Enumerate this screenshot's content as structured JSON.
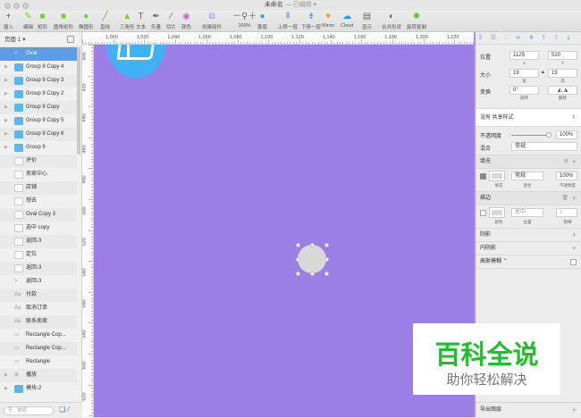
{
  "window": {
    "title": "未命名",
    "status": "— 已编辑 ▾"
  },
  "toolbar": {
    "items": [
      {
        "label": "插入",
        "icon": "plus-icon"
      },
      {
        "label": "编辑",
        "icon": "edit-icon"
      },
      {
        "label": "矩形",
        "icon": "rectangle-icon"
      },
      {
        "label": "圆角矩形",
        "icon": "rounded-rectangle-icon"
      },
      {
        "label": "椭圆形",
        "icon": "oval-icon"
      },
      {
        "label": "直线",
        "icon": "line-icon"
      },
      {
        "label": "三角形",
        "icon": "triangle-icon"
      },
      {
        "label": "文本",
        "icon": "text-icon"
      },
      {
        "label": "矢量",
        "icon": "vector-icon"
      },
      {
        "label": "切片",
        "icon": "slice-icon"
      },
      {
        "label": "颜色",
        "icon": "color-wheel-icon"
      },
      {
        "label": "创建组件",
        "icon": "symbol-icon"
      },
      {
        "label": "309%",
        "icon": "zoom-icon"
      },
      {
        "label": "蒙版",
        "icon": "mask-icon"
      },
      {
        "label": "上移一层",
        "icon": "forward-icon"
      },
      {
        "label": "下移一层",
        "icon": "backward-icon"
      },
      {
        "label": "Mirror",
        "icon": "mirror-icon"
      },
      {
        "label": "Cloud",
        "icon": "cloud-icon"
      },
      {
        "label": "显示",
        "icon": "view-icon"
      },
      {
        "label": "合并形状",
        "icon": "combine-icon"
      },
      {
        "label": "旋转复制",
        "icon": "rotate-copy-icon"
      }
    ]
  },
  "layers": {
    "page": "页面 1 ▾",
    "search_placeholder": "搜索",
    "items": [
      {
        "label": "Oval",
        "type": "oval"
      },
      {
        "label": "Group 9 Copy 4",
        "type": "group"
      },
      {
        "label": "Group 9 Copy 3",
        "type": "group"
      },
      {
        "label": "Group 9 Copy 2",
        "type": "group"
      },
      {
        "label": "Group 9 Copy",
        "type": "group"
      },
      {
        "label": "Group 9 Copy 5",
        "type": "group"
      },
      {
        "label": "Group 9 Copy 6",
        "type": "group"
      },
      {
        "label": "Group 9",
        "type": "group"
      },
      {
        "label": "评价",
        "type": "bitmap"
      },
      {
        "label": "卖家中心",
        "type": "bitmap"
      },
      {
        "label": "店铺",
        "type": "bitmap"
      },
      {
        "label": "想去",
        "type": "bitmap"
      },
      {
        "label": "Oval Copy 3",
        "type": "bitmap"
      },
      {
        "label": "选中 copy",
        "type": "bitmap"
      },
      {
        "label": "返回-3",
        "type": "bitmap"
      },
      {
        "label": "定位",
        "type": "bitmap"
      },
      {
        "label": "返回-3",
        "type": "bitmap"
      },
      {
        "label": "返回-3",
        "type": "path"
      },
      {
        "label": "付款",
        "type": "text"
      },
      {
        "label": "取消订单",
        "type": "text"
      },
      {
        "label": "联系卖家",
        "type": "text"
      },
      {
        "label": "Rectangle Cop...",
        "type": "rect"
      },
      {
        "label": "Rectangle Cop...",
        "type": "rect"
      },
      {
        "label": "Rectangle",
        "type": "rect"
      },
      {
        "label": "播放",
        "type": "symbol"
      },
      {
        "label": "模块-2",
        "type": "group"
      }
    ]
  },
  "rulers": {
    "h": [
      "1,000",
      "1,020",
      "1,040",
      "1,060",
      "1,080",
      "1,100",
      "1,120",
      "1,140",
      "1,160",
      "1,180",
      "1,200",
      "1,220"
    ],
    "v": [
      "400",
      "420",
      "440",
      "460",
      "480",
      "500",
      "520",
      "540",
      "560",
      "580",
      "600",
      "620"
    ]
  },
  "inspector": {
    "position_label": "位置",
    "x": "1125",
    "y": "520",
    "x_cap": "X",
    "y_cap": "Y",
    "size_label": "大小",
    "w": "19",
    "h": "19",
    "w_cap": "宽",
    "h_cap": "高",
    "transform_label": "变换",
    "rotate": "0°",
    "rotate_cap": "旋转",
    "flip_cap": "翻转",
    "shared_style": "没有 共享样式",
    "opacity_label": "不透明度",
    "opacity": "100%",
    "opacity_value": 1.0,
    "blend_label": "混合",
    "blend": "常规",
    "fill_label": "填充",
    "fill_blend": "常规",
    "fill_opacity": "100%",
    "fill_cap": "填充",
    "fill_blend_cap": "混合",
    "fill_opacity_cap": "不透明度",
    "border_label": "描边",
    "border_pos": "居中",
    "border_width": "1",
    "border_color_cap": "颜色",
    "border_pos_cap": "位置",
    "border_width_cap": "粗细",
    "shadow": "阴影",
    "inner_shadow": "内阴影",
    "blur": "高斯模糊 ⌃",
    "export": "导出图层"
  },
  "watermark": {
    "title": "百科全说",
    "subtitle": "助你轻松解决"
  },
  "colors": {
    "canvas": "#9b7fe6",
    "selection": "#5b9de8",
    "watermark_green": "#1fbf2b"
  }
}
